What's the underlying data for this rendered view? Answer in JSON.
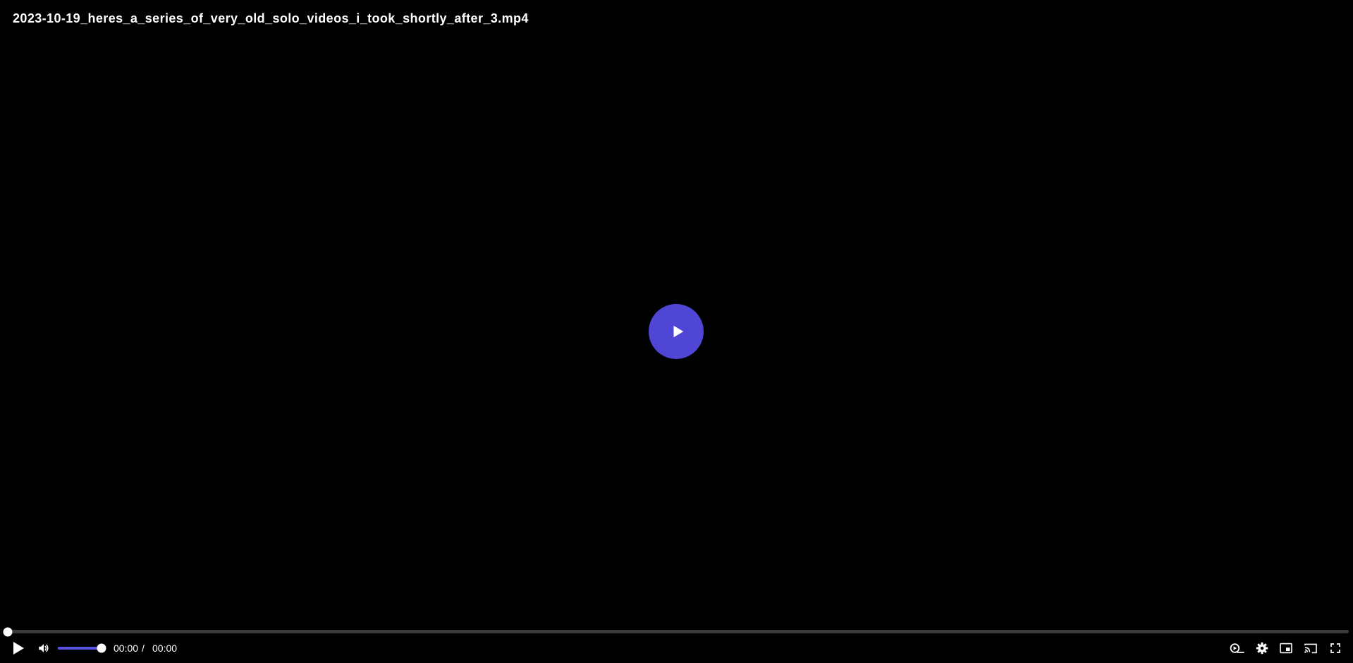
{
  "video": {
    "title": "2023-10-19_heres_a_series_of_very_old_solo_videos_i_took_shortly_after_3.mp4"
  },
  "playback": {
    "current_time": "00:00",
    "separator": "/",
    "duration": "00:00",
    "progress_fraction": 0,
    "volume_fraction": 1
  },
  "colors": {
    "accent": "#5a52e0",
    "big_play_background": "#4f46d6",
    "track": "#3a3a3a",
    "background": "#000000"
  },
  "icons": {
    "big_play": "play-icon",
    "play": "play-icon",
    "mute": "volume-icon",
    "speed": "playback-speed-icon",
    "settings": "gear-icon",
    "pip": "picture-in-picture-icon",
    "cast": "cast-icon",
    "fullscreen": "fullscreen-icon"
  }
}
